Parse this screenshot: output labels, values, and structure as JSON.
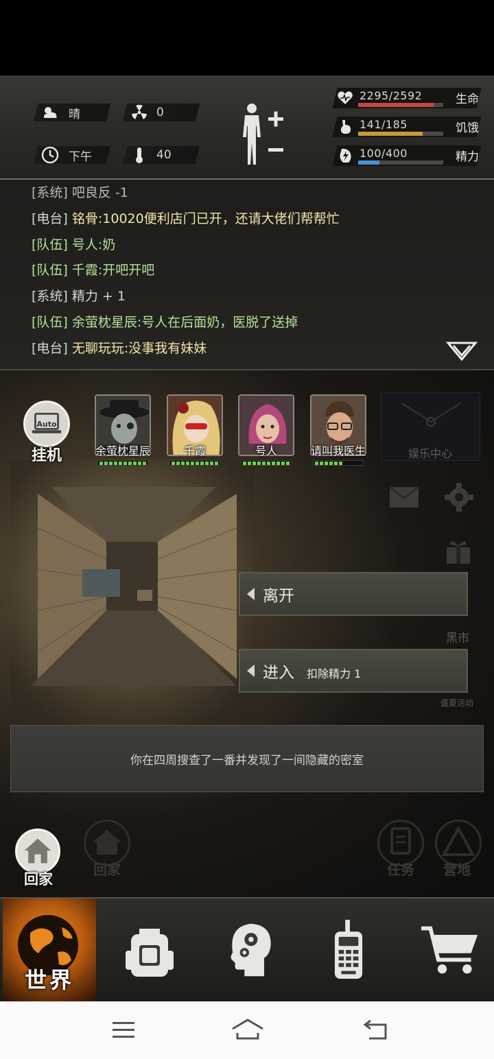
{
  "status": {
    "weather": "晴",
    "radiation": "0",
    "time_of_day": "下午",
    "temperature": "40",
    "stats": [
      {
        "name": "生命",
        "value": "2295/2592",
        "fraction": 0.885,
        "color": "#c8463e",
        "icon": "heart-icon"
      },
      {
        "name": "饥饿",
        "value": "141/185",
        "fraction": 0.762,
        "color": "#c89a3a",
        "icon": "stomach-icon"
      },
      {
        "name": "精力",
        "value": "100/400",
        "fraction": 0.25,
        "color": "#4a90d0",
        "icon": "energy-icon"
      }
    ]
  },
  "chat": {
    "lines": [
      {
        "channel": "[系统]",
        "text": "吧良反 -1",
        "type": "sys"
      },
      {
        "channel": "[电台]",
        "text": "铭骨:10020便利店门已开，还请大佬们帮帮忙",
        "type": "radio"
      },
      {
        "channel": "[队伍]",
        "text": "号人:奶",
        "type": "team"
      },
      {
        "channel": "[队伍]",
        "text": "千霞:开吧开吧",
        "type": "team"
      },
      {
        "channel": "[系统]",
        "text": "精力 + 1",
        "type": "sys"
      },
      {
        "channel": "[队伍]",
        "text": "余萤枕星辰:号人在后面奶，医脱了送掉",
        "type": "team"
      },
      {
        "channel": "[电台]",
        "text": "无聊玩玩:没事我有妹妹",
        "type": "radio"
      }
    ]
  },
  "auto": {
    "icon_text": "Auto",
    "label": "挂机"
  },
  "team": [
    {
      "name": "余萤枕星辰",
      "hp_segments": 10
    },
    {
      "name": "千霞",
      "hp_segments": 10
    },
    {
      "name": "号人",
      "hp_segments": 10
    },
    {
      "name": "请叫我医生",
      "hp_segments": 6
    }
  ],
  "side": {
    "fun_center": "娱乐中心",
    "black_market": "黑市",
    "event": "盛夏活动"
  },
  "actions": {
    "leave": {
      "label": "离开"
    },
    "enter": {
      "label": "进入",
      "cost": "扣除精力 1"
    }
  },
  "message": "你在四周搜查了一番并发现了一间隐藏的密室",
  "home": {
    "label": "回家",
    "faded_label": "回家"
  },
  "faded": {
    "task": "任务",
    "camp": "营地"
  },
  "nav": {
    "world": "世界",
    "items": [
      "backpack-icon",
      "skills-head-icon",
      "radio-icon",
      "cart-icon"
    ]
  }
}
